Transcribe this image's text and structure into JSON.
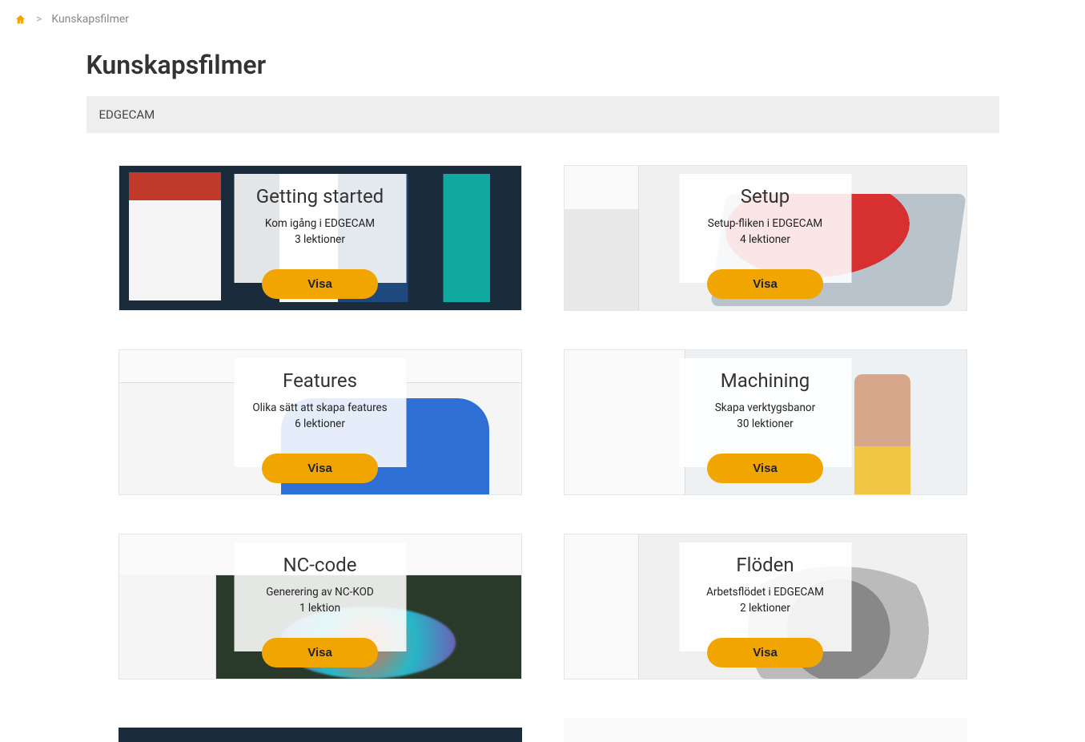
{
  "breadcrumb": {
    "current": "Kunskapsfilmer"
  },
  "page": {
    "title": "Kunskapsfilmer",
    "section": "EDGECAM"
  },
  "cards": [
    {
      "title": "Getting started",
      "desc": "Kom igång i EDGECAM",
      "lessons": "3 lektioner",
      "button": "Visa"
    },
    {
      "title": "Setup",
      "desc": "Setup-fliken i EDGECAM",
      "lessons": "4 lektioner",
      "button": "Visa"
    },
    {
      "title": "Features",
      "desc": "Olika sätt att skapa features",
      "lessons": "6 lektioner",
      "button": "Visa"
    },
    {
      "title": "Machining",
      "desc": "Skapa verktygsbanor",
      "lessons": "30 lektioner",
      "button": "Visa"
    },
    {
      "title": "NC-code",
      "desc": "Generering av NC-KOD",
      "lessons": "1 lektion",
      "button": "Visa"
    },
    {
      "title": "Flöden",
      "desc": "Arbetsflödet i EDGECAM",
      "lessons": "2 lektioner",
      "button": "Visa"
    }
  ]
}
